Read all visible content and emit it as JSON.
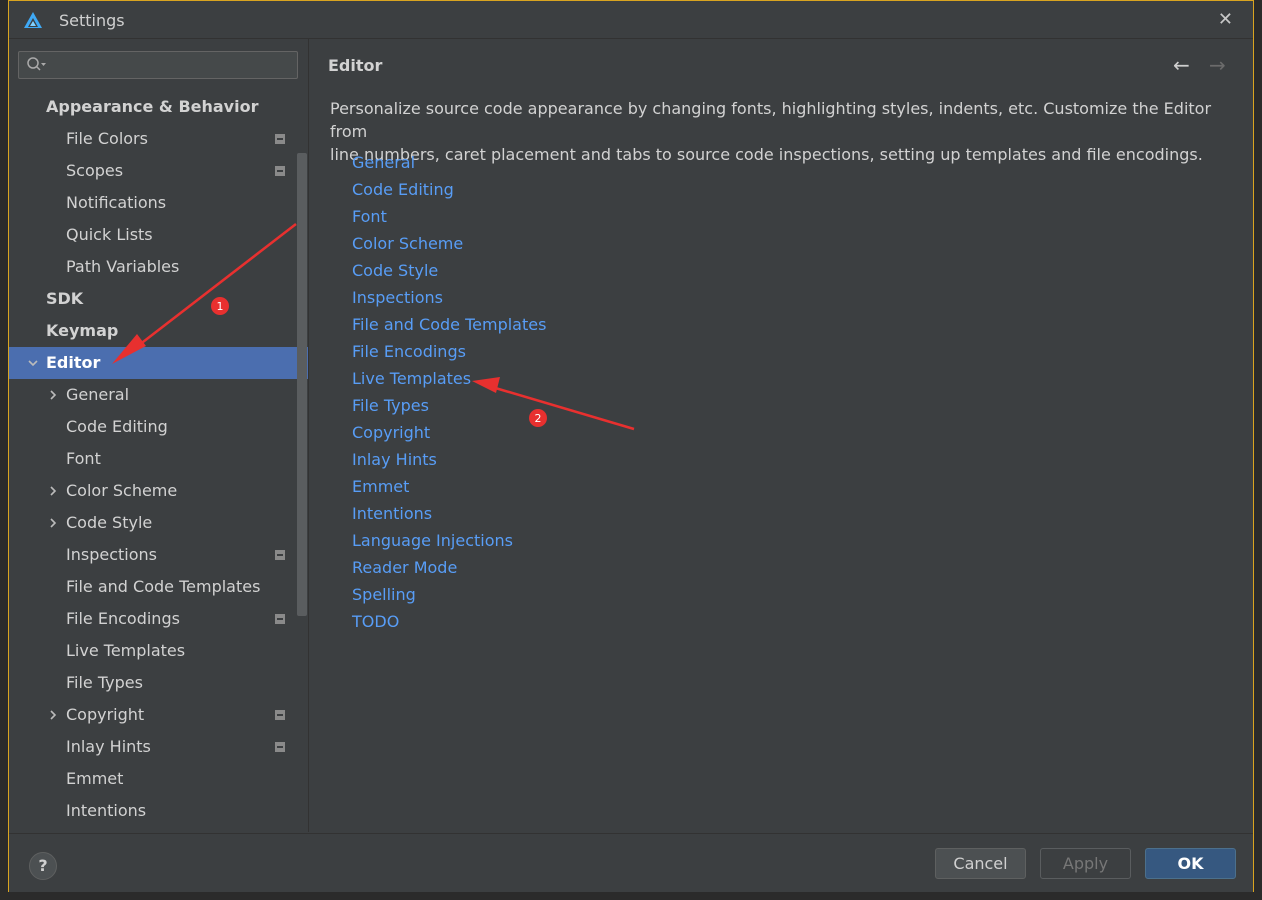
{
  "window": {
    "title": "Settings"
  },
  "search": {
    "value": "",
    "placeholder": ""
  },
  "sidebar": {
    "items": [
      {
        "label": "Appearance & Behavior",
        "level": 0,
        "bold": true
      },
      {
        "label": "File Colors",
        "level": 1,
        "badge": true
      },
      {
        "label": "Scopes",
        "level": 1,
        "badge": true
      },
      {
        "label": "Notifications",
        "level": 1
      },
      {
        "label": "Quick Lists",
        "level": 1
      },
      {
        "label": "Path Variables",
        "level": 1
      },
      {
        "label": "SDK",
        "level": 0,
        "bold": true
      },
      {
        "label": "Keymap",
        "level": 0,
        "bold": true
      },
      {
        "label": "Editor",
        "level": 0,
        "bold": true,
        "expanded": true,
        "selected": true
      },
      {
        "label": "General",
        "level": 1,
        "collapsed": true
      },
      {
        "label": "Code Editing",
        "level": 1
      },
      {
        "label": "Font",
        "level": 1
      },
      {
        "label": "Color Scheme",
        "level": 1,
        "collapsed": true
      },
      {
        "label": "Code Style",
        "level": 1,
        "collapsed": true
      },
      {
        "label": "Inspections",
        "level": 1,
        "badge": true
      },
      {
        "label": "File and Code Templates",
        "level": 1
      },
      {
        "label": "File Encodings",
        "level": 1,
        "badge": true
      },
      {
        "label": "Live Templates",
        "level": 1
      },
      {
        "label": "File Types",
        "level": 1
      },
      {
        "label": "Copyright",
        "level": 1,
        "collapsed": true,
        "badge": true
      },
      {
        "label": "Inlay Hints",
        "level": 1,
        "badge": true
      },
      {
        "label": "Emmet",
        "level": 1
      },
      {
        "label": "Intentions",
        "level": 1
      }
    ]
  },
  "content": {
    "title": "Editor",
    "description_line1": "Personalize source code appearance by changing fonts, highlighting styles, indents, etc. Customize the Editor from",
    "description_line2": "line numbers, caret placement and tabs to source code inspections, setting up templates and file encodings.",
    "links": [
      "General",
      "Code Editing",
      "Font",
      "Color Scheme",
      "Code Style",
      "Inspections",
      "File and Code Templates",
      "File Encodings",
      "Live Templates",
      "File Types",
      "Copyright",
      "Inlay Hints",
      "Emmet",
      "Intentions",
      "Language Injections",
      "Reader Mode",
      "Spelling",
      "TODO"
    ]
  },
  "nav": {
    "back": "←",
    "forward": "→"
  },
  "footer": {
    "help": "?",
    "cancel": "Cancel",
    "apply": "Apply",
    "ok": "OK"
  },
  "annotations": {
    "marker1": "1",
    "marker2": "2"
  },
  "colors": {
    "accent": "#4b6eaf",
    "link": "#589df6",
    "annotation": "#e8302f",
    "window_border": "#d9a420"
  },
  "icons": [
    "app-logo-icon",
    "close-icon",
    "search-icon",
    "chevron-down-icon",
    "chevron-right-icon",
    "project-scope-icon",
    "back-arrow-icon",
    "forward-arrow-icon",
    "help-icon"
  ]
}
